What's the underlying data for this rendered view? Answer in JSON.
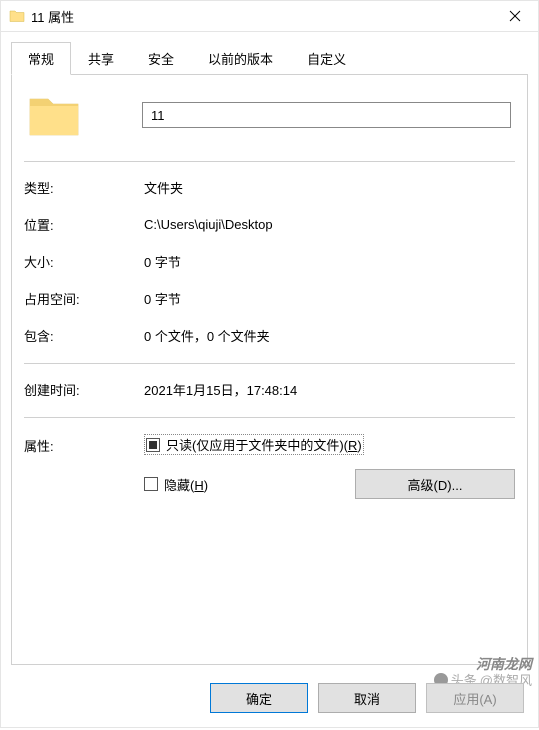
{
  "titlebar": {
    "title": "11 属性"
  },
  "tabs": {
    "items": [
      {
        "label": "常规",
        "active": true
      },
      {
        "label": "共享",
        "active": false
      },
      {
        "label": "安全",
        "active": false
      },
      {
        "label": "以前的版本",
        "active": false
      },
      {
        "label": "自定义",
        "active": false
      }
    ]
  },
  "general": {
    "name": "11",
    "type_label": "类型:",
    "type_value": "文件夹",
    "location_label": "位置:",
    "location_value": "C:\\Users\\qiuji\\Desktop",
    "size_label": "大小:",
    "size_value": "0 字节",
    "size_ondisk_label": "占用空间:",
    "size_ondisk_value": "0 字节",
    "contains_label": "包含:",
    "contains_value": "0 个文件，0 个文件夹",
    "created_label": "创建时间:",
    "created_value": "2021年1月15日，17:48:14",
    "attributes_label": "属性:",
    "readonly_label_prefix": "只读(仅应用于文件夹中的文件)(",
    "readonly_hotkey": "R",
    "readonly_label_suffix": ")",
    "hidden_label_prefix": "隐藏(",
    "hidden_hotkey": "H",
    "hidden_label_suffix": ")",
    "advanced_label": "高级(D)..."
  },
  "buttons": {
    "ok": "确定",
    "cancel": "取消",
    "apply": "应用(A)"
  },
  "watermark": {
    "source": "头条",
    "author": "@数智风",
    "site": "河南龙网"
  }
}
